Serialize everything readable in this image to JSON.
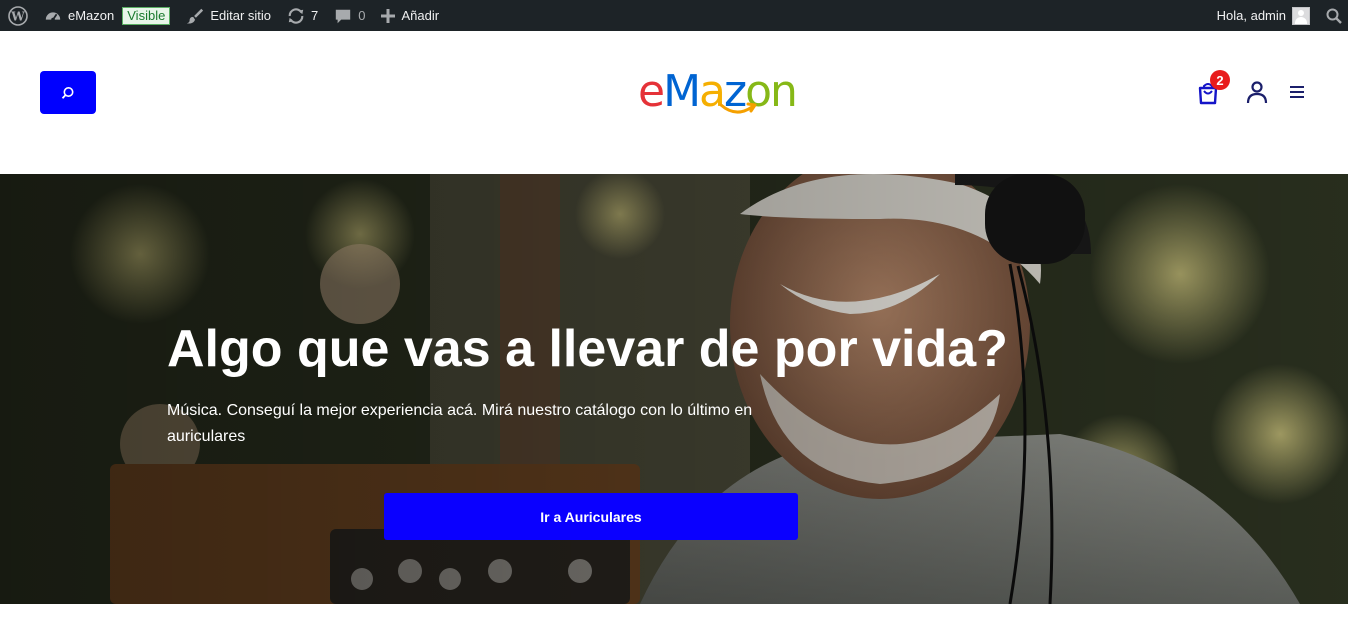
{
  "adminbar": {
    "site_name": "eMazon",
    "visibility_badge": "Visible",
    "edit_site": "Editar sitio",
    "updates_count": "7",
    "comments_count": "0",
    "add_new": "Añadir",
    "greeting": "Hola, admin"
  },
  "header": {
    "logo": {
      "letters": [
        {
          "char": "e",
          "color": "#e53238"
        },
        {
          "char": "M",
          "color": "#0064d2"
        },
        {
          "char": "a",
          "color": "#f5af02"
        },
        {
          "char": "z",
          "color": "#0064d2"
        },
        {
          "char": "o",
          "color": "#86b817"
        },
        {
          "char": "n",
          "color": "#86b817"
        }
      ],
      "smile_color": "#f5a000"
    },
    "cart_count": "2",
    "icons": [
      "search-icon",
      "cart-icon",
      "user-icon",
      "menu-icon"
    ]
  },
  "hero": {
    "title": "Algo que vas a llevar de por vida?",
    "subtitle": "Música. Conseguí la mejor experiencia acá. Mirá nuestro catálogo con lo último en auriculares",
    "cta_label": "Ir a Auriculares"
  },
  "colors": {
    "adminbar_bg": "#1d2327",
    "accent_blue": "#0000ff",
    "cta_blue": "#0a00ff",
    "badge_red": "#e81c1c",
    "icon_navy": "#1b1f6b"
  }
}
